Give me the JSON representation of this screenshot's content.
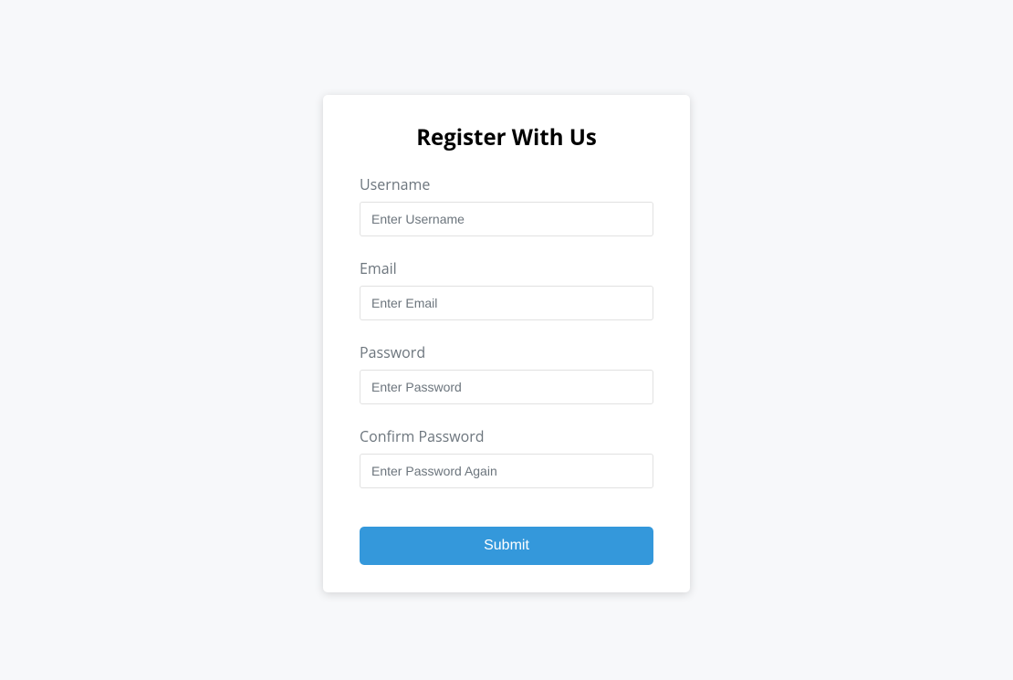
{
  "form": {
    "title": "Register With Us",
    "fields": {
      "username": {
        "label": "Username",
        "placeholder": "Enter Username",
        "value": ""
      },
      "email": {
        "label": "Email",
        "placeholder": "Enter Email",
        "value": ""
      },
      "password": {
        "label": "Password",
        "placeholder": "Enter Password",
        "value": ""
      },
      "confirmPassword": {
        "label": "Confirm Password",
        "placeholder": "Enter Password Again",
        "value": ""
      }
    },
    "submitLabel": "Submit"
  }
}
